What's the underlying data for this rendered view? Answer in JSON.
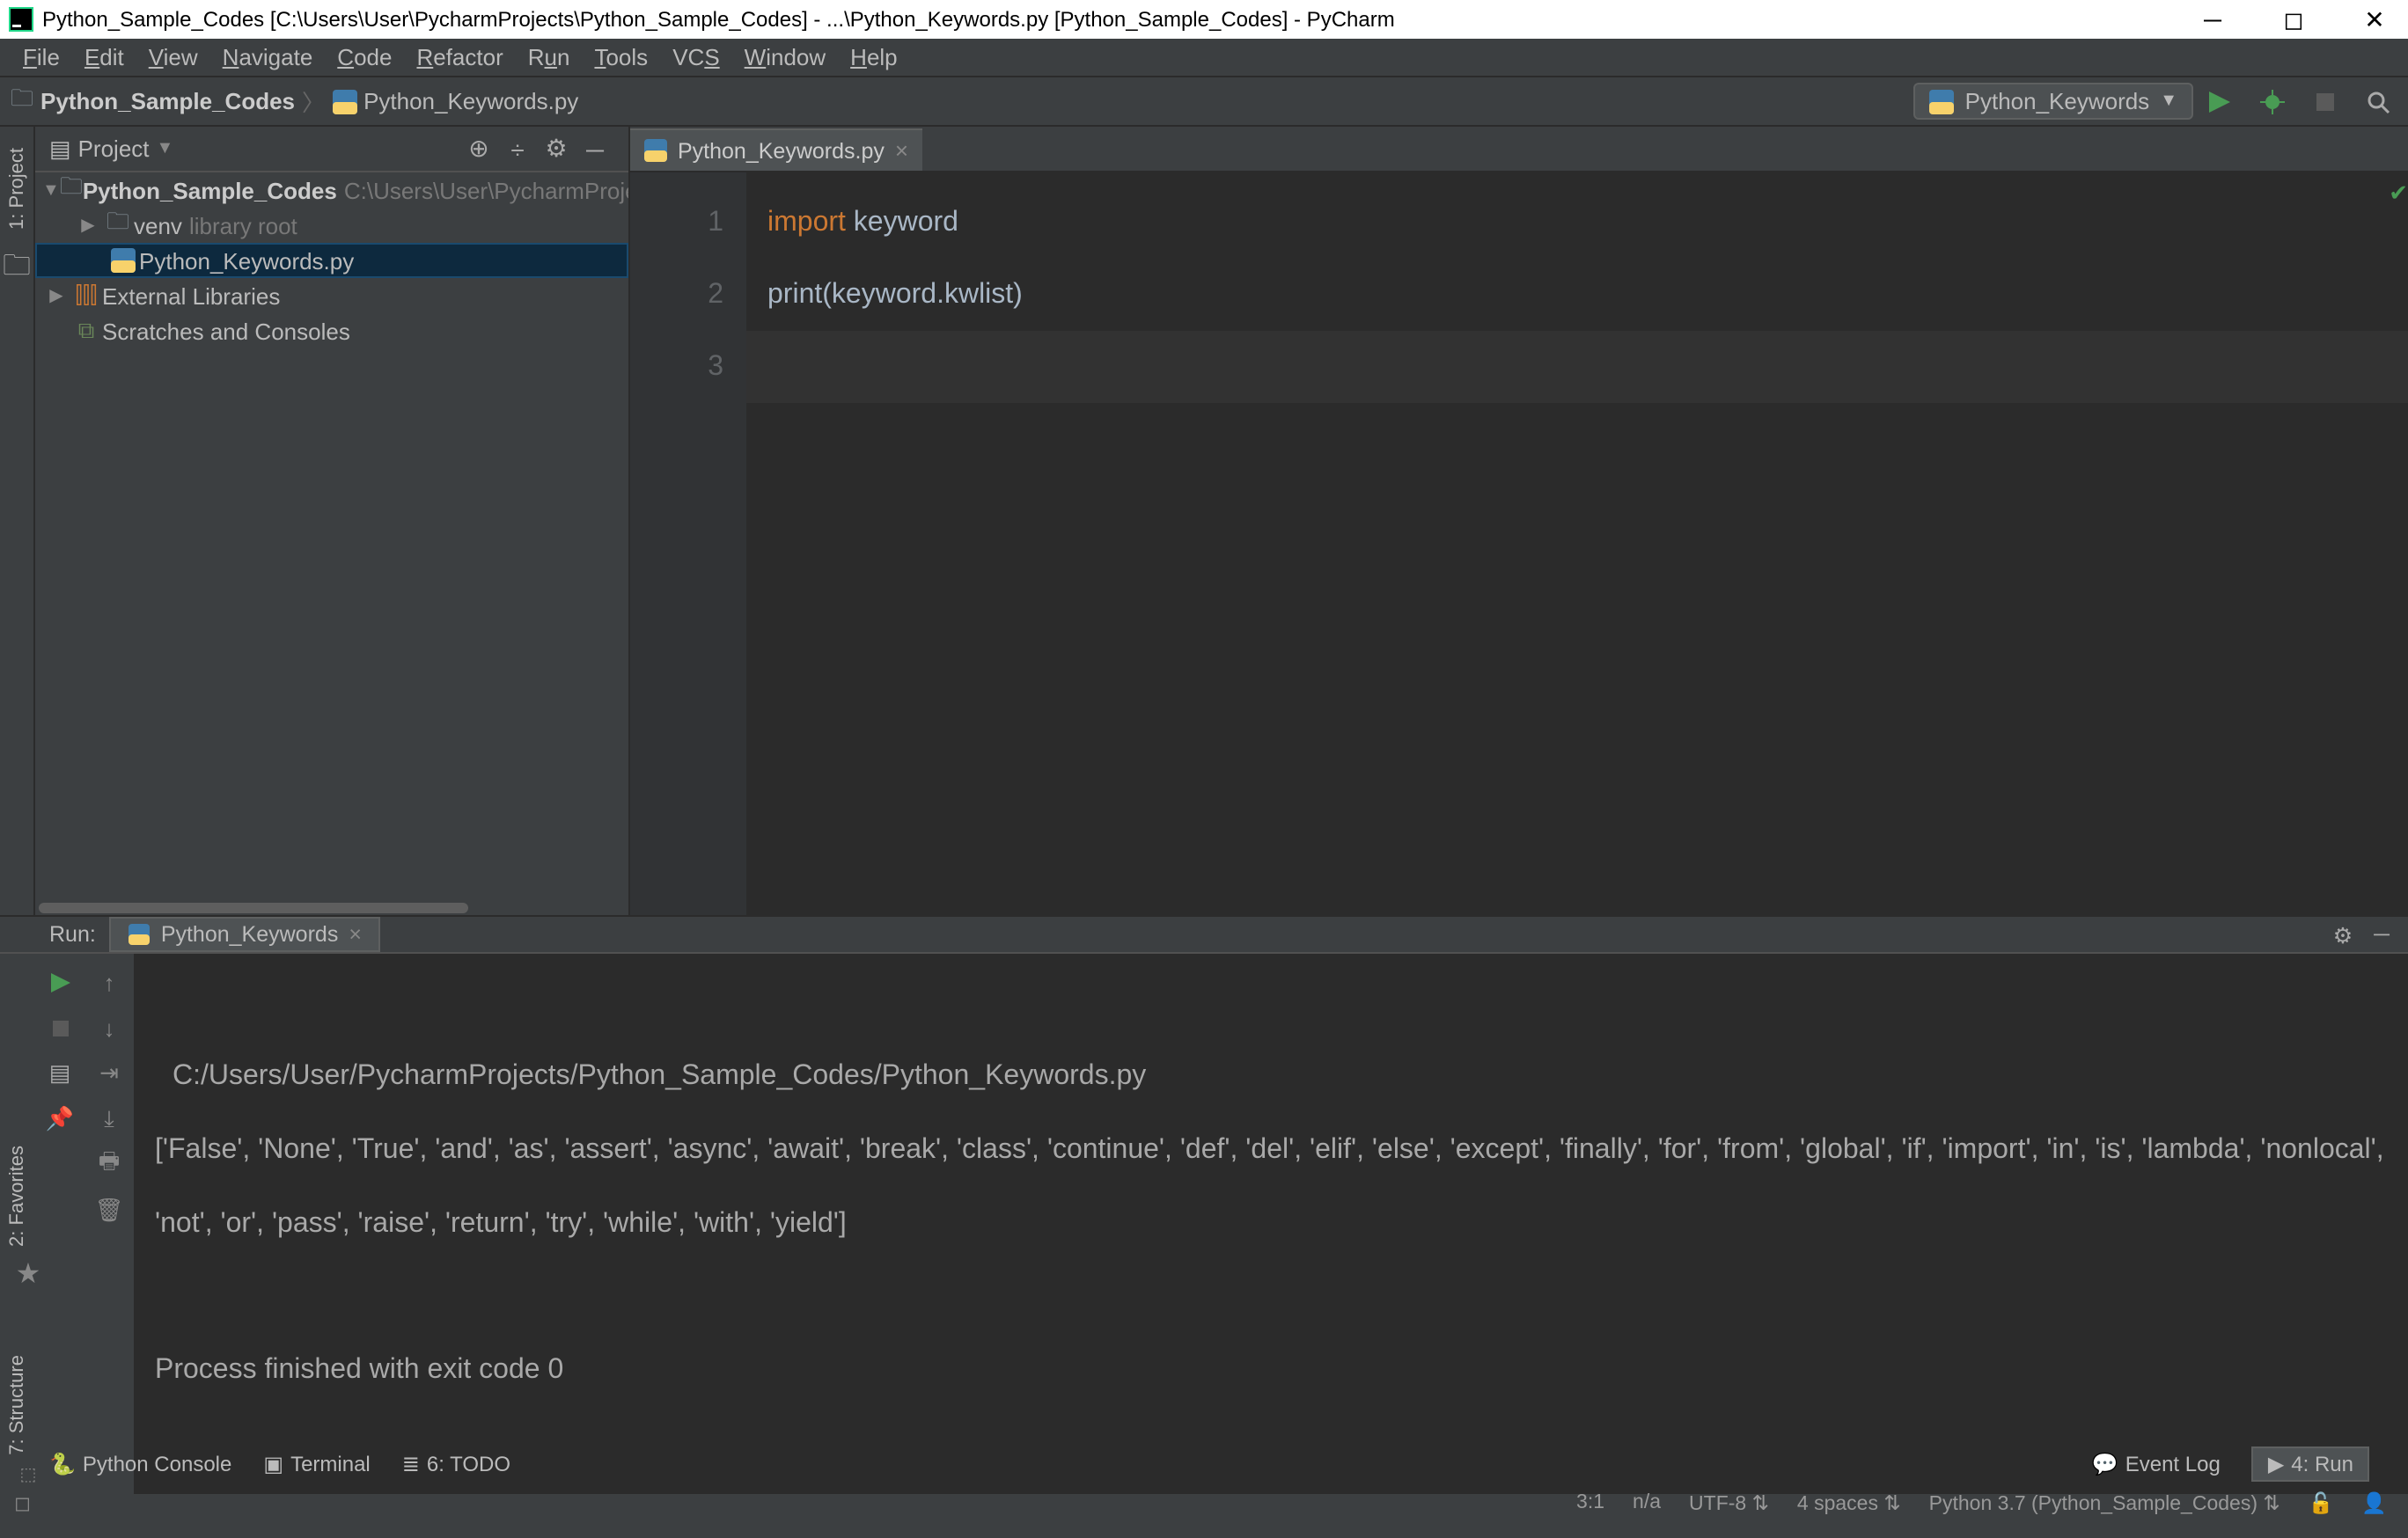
{
  "titlebar": {
    "title": "Python_Sample_Codes [C:\\Users\\User\\PycharmProjects\\Python_Sample_Codes] - ...\\Python_Keywords.py [Python_Sample_Codes] - PyCharm"
  },
  "menu": {
    "file": "File",
    "edit": "Edit",
    "view": "View",
    "navigate": "Navigate",
    "code": "Code",
    "refactor": "Refactor",
    "run": "Run",
    "tools": "Tools",
    "vcs": "VCS",
    "window": "Window",
    "help": "Help"
  },
  "breadcrumb": {
    "project": "Python_Sample_Codes",
    "file": "Python_Keywords.py"
  },
  "run_config": "Python_Keywords",
  "project_panel": {
    "title": "Project",
    "root": "Python_Sample_Codes",
    "root_path": "C:\\Users\\User\\PycharmProjects\\Python_Sample_Codes",
    "venv": "venv",
    "venv_note": "library root",
    "file1": "Python_Keywords.py",
    "external": "External Libraries",
    "scratches": "Scratches and Consoles"
  },
  "editor": {
    "tab": "Python_Keywords.py",
    "lines": {
      "l1_kw": "import",
      "l1_rest": " keyword",
      "l2_fn": "print",
      "l2_rest": "(keyword.kwlist)"
    },
    "gutter": {
      "n1": "1",
      "n2": "2",
      "n3": "3"
    }
  },
  "run": {
    "label": "Run:",
    "tab": "Python_Keywords",
    "output_path": "C:/Users/User/PycharmProjects/Python_Sample_Codes/Python_Keywords.py",
    "output_list": "['False', 'None', 'True', 'and', 'as', 'assert', 'async', 'await', 'break', 'class', 'continue', 'def', 'del', 'elif', 'else', 'except', 'finally', 'for', 'from', 'global', 'if', 'import', 'in', 'is', 'lambda', 'nonlocal', 'not', 'or', 'pass', 'raise', 'return', 'try', 'while', 'with', 'yield']",
    "exit": "Process finished with exit code 0"
  },
  "bottombar": {
    "python_console": "Python Console",
    "terminal": "Terminal",
    "todo": "6: TODO",
    "event_log": "Event Log",
    "run_btn": "4: Run"
  },
  "statusbar": {
    "caret": "3:1",
    "na": "n/a",
    "encoding": "UTF-8",
    "indent": "4 spaces",
    "interpreter": "Python 3.7 (Python_Sample_Codes)"
  },
  "sidetabs": {
    "project": "1: Project",
    "favorites": "2: Favorites",
    "structure": "7: Structure"
  }
}
